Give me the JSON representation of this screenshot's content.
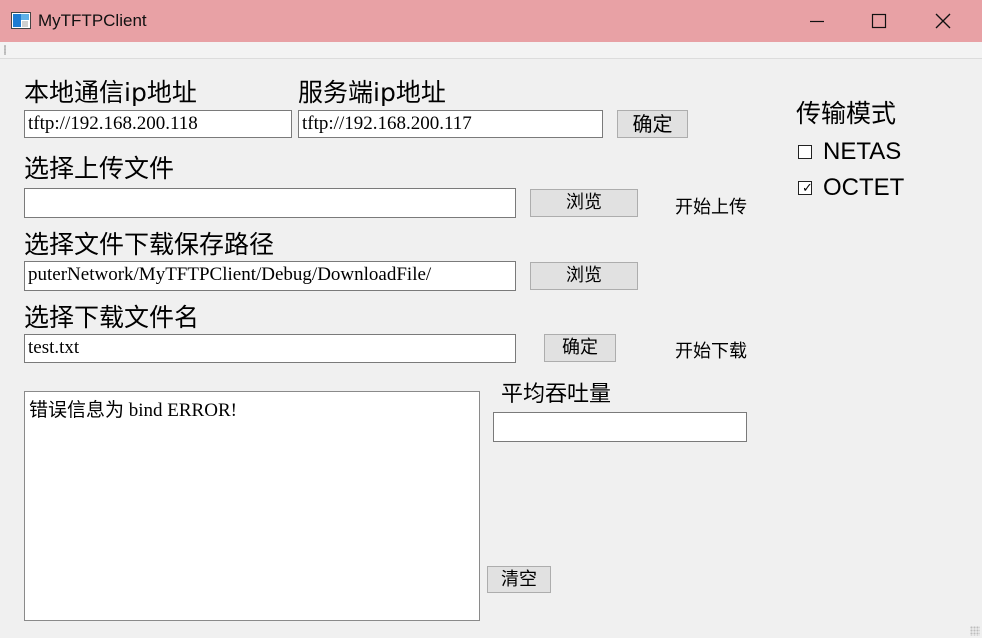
{
  "window": {
    "title": "MyTFTPClient",
    "titlebar_color": "#e8a1a5",
    "controls": [
      "minimize-icon",
      "maximize-icon",
      "close-icon"
    ]
  },
  "local_ip": {
    "label": "本地通信ip地址",
    "value": "tftp://192.168.200.118"
  },
  "server_ip": {
    "label": "服务端ip地址",
    "value": "tftp://192.168.200.117",
    "confirm_label": "确定"
  },
  "upload": {
    "label": "选择上传文件",
    "value": "",
    "browse_label": "浏览",
    "start_label": "开始上传"
  },
  "download_path": {
    "label": "选择文件下载保存路径",
    "value": "puterNetwork/MyTFTPClient/Debug/DownloadFile/",
    "browse_label": "浏览"
  },
  "download_file": {
    "label": "选择下载文件名",
    "value": "test.txt",
    "confirm_label": "确定",
    "start_label": "开始下载"
  },
  "mode": {
    "label": "传输模式",
    "options": [
      {
        "label": "NETAS",
        "checked": false
      },
      {
        "label": "OCTET",
        "checked": true
      }
    ]
  },
  "log": {
    "text": "错误信息为 bind ERROR!"
  },
  "throughput": {
    "label": "平均吞吐量",
    "value": ""
  },
  "clear_label": "清空"
}
